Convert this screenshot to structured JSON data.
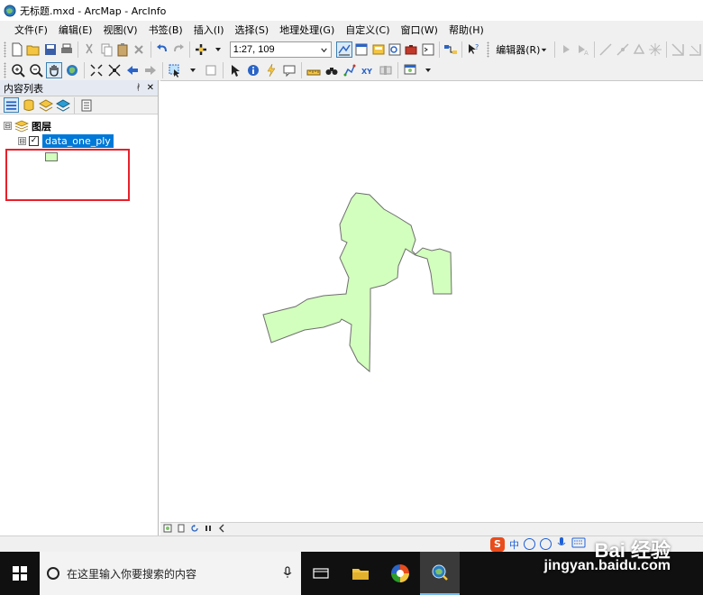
{
  "window": {
    "title": "无标题.mxd - ArcMap - ArcInfo"
  },
  "menubar": {
    "items": [
      "文件(F)",
      "编辑(E)",
      "视图(V)",
      "书签(B)",
      "插入(I)",
      "选择(S)",
      "地理处理(G)",
      "自定义(C)",
      "窗口(W)",
      "帮助(H)"
    ]
  },
  "toolbar": {
    "scale_value": "1:27, 109",
    "editor_label": "编辑器(R)"
  },
  "toc": {
    "title": "内容列表",
    "pin_label": "ᚯ",
    "close_label": "✕",
    "root_layer_group": "图层",
    "root_expander": "⊟",
    "layer_expander": "⊟",
    "layer_checkbox": "✓",
    "layer_name": "data_one_ply",
    "layer_visible": true,
    "highlight_color": "#e8202a"
  },
  "map": {
    "polygon_fill": "#d3ffbe",
    "polygon_outline": "#6e6e6e"
  },
  "statusbar": {
    "ime_logo": "S",
    "ime_lang": "中"
  },
  "taskbar": {
    "search_placeholder": "在这里输入你要搜索的内容"
  },
  "watermark": {
    "logo_text": "Bai 经验",
    "url": "jingyan.baidu.com"
  },
  "colors": {
    "accent_blue": "#0078d7",
    "red_highlight": "#e8202a",
    "polygon_fill": "#d3ffbe"
  }
}
